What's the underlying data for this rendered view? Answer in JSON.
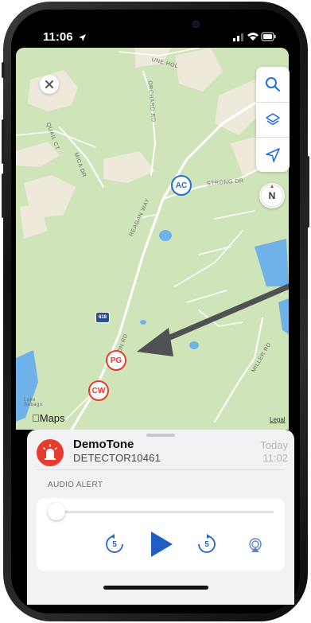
{
  "status_bar": {
    "time": "11:06"
  },
  "map": {
    "road_labels": {
      "orchard": "ORCHARD RD",
      "quail": "QUAIL CT",
      "mica": "MICA DR",
      "strong": "STRONG DR",
      "reagan": "REAGAN WAY",
      "kenyon": "KENYON RD",
      "miller": "MILLER RD",
      "top": "UNE HOL"
    },
    "lake_label": "Lake\nSebago",
    "route_shield": "618",
    "markers": [
      {
        "code": "AC",
        "color": "#1f6fe0"
      },
      {
        "code": "PG",
        "color": "#e53c2c"
      },
      {
        "code": "CW",
        "color": "#e53c2c"
      }
    ],
    "attribution": "Maps",
    "legal_link": "Legal",
    "compass": "N",
    "colors": {
      "land": "#cfe5b9",
      "water": "#6fb2ea",
      "residential": "#efe9dc",
      "road": "#ffffff",
      "arrow": "#4f5152"
    }
  },
  "controls": {
    "close_icon": "close-icon",
    "search_icon": "search-icon",
    "layers_icon": "layers-icon",
    "location_icon": "location-arrow-icon"
  },
  "alert": {
    "title": "DemoTone",
    "detector": "DETECTOR10461",
    "day": "Today",
    "time": "11:02",
    "section_label": "AUDIO ALERT",
    "icon": "siren-icon",
    "accent": "#e53c2c"
  },
  "player": {
    "progress": 0,
    "skip_back_seconds": "5",
    "skip_forward_seconds": "5",
    "play_icon": "play-icon",
    "airplay_icon": "airplay-icon",
    "accent": "#1f5fc4"
  }
}
